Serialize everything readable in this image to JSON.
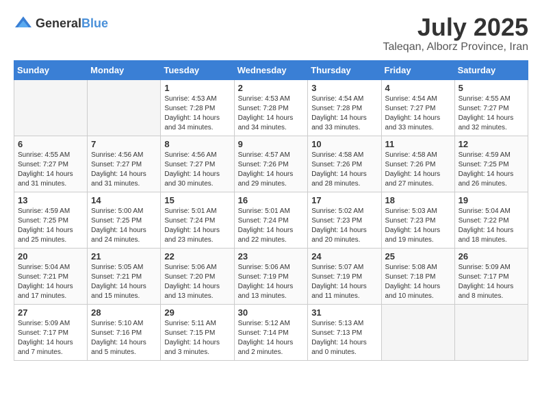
{
  "header": {
    "logo_general": "General",
    "logo_blue": "Blue",
    "month": "July 2025",
    "location": "Taleqan, Alborz Province, Iran"
  },
  "days_of_week": [
    "Sunday",
    "Monday",
    "Tuesday",
    "Wednesday",
    "Thursday",
    "Friday",
    "Saturday"
  ],
  "weeks": [
    [
      {
        "day": "",
        "sunrise": "",
        "sunset": "",
        "daylight": ""
      },
      {
        "day": "",
        "sunrise": "",
        "sunset": "",
        "daylight": ""
      },
      {
        "day": "1",
        "sunrise": "Sunrise: 4:53 AM",
        "sunset": "Sunset: 7:28 PM",
        "daylight": "Daylight: 14 hours and 34 minutes."
      },
      {
        "day": "2",
        "sunrise": "Sunrise: 4:53 AM",
        "sunset": "Sunset: 7:28 PM",
        "daylight": "Daylight: 14 hours and 34 minutes."
      },
      {
        "day": "3",
        "sunrise": "Sunrise: 4:54 AM",
        "sunset": "Sunset: 7:28 PM",
        "daylight": "Daylight: 14 hours and 33 minutes."
      },
      {
        "day": "4",
        "sunrise": "Sunrise: 4:54 AM",
        "sunset": "Sunset: 7:27 PM",
        "daylight": "Daylight: 14 hours and 33 minutes."
      },
      {
        "day": "5",
        "sunrise": "Sunrise: 4:55 AM",
        "sunset": "Sunset: 7:27 PM",
        "daylight": "Daylight: 14 hours and 32 minutes."
      }
    ],
    [
      {
        "day": "6",
        "sunrise": "Sunrise: 4:55 AM",
        "sunset": "Sunset: 7:27 PM",
        "daylight": "Daylight: 14 hours and 31 minutes."
      },
      {
        "day": "7",
        "sunrise": "Sunrise: 4:56 AM",
        "sunset": "Sunset: 7:27 PM",
        "daylight": "Daylight: 14 hours and 31 minutes."
      },
      {
        "day": "8",
        "sunrise": "Sunrise: 4:56 AM",
        "sunset": "Sunset: 7:27 PM",
        "daylight": "Daylight: 14 hours and 30 minutes."
      },
      {
        "day": "9",
        "sunrise": "Sunrise: 4:57 AM",
        "sunset": "Sunset: 7:26 PM",
        "daylight": "Daylight: 14 hours and 29 minutes."
      },
      {
        "day": "10",
        "sunrise": "Sunrise: 4:58 AM",
        "sunset": "Sunset: 7:26 PM",
        "daylight": "Daylight: 14 hours and 28 minutes."
      },
      {
        "day": "11",
        "sunrise": "Sunrise: 4:58 AM",
        "sunset": "Sunset: 7:26 PM",
        "daylight": "Daylight: 14 hours and 27 minutes."
      },
      {
        "day": "12",
        "sunrise": "Sunrise: 4:59 AM",
        "sunset": "Sunset: 7:25 PM",
        "daylight": "Daylight: 14 hours and 26 minutes."
      }
    ],
    [
      {
        "day": "13",
        "sunrise": "Sunrise: 4:59 AM",
        "sunset": "Sunset: 7:25 PM",
        "daylight": "Daylight: 14 hours and 25 minutes."
      },
      {
        "day": "14",
        "sunrise": "Sunrise: 5:00 AM",
        "sunset": "Sunset: 7:25 PM",
        "daylight": "Daylight: 14 hours and 24 minutes."
      },
      {
        "day": "15",
        "sunrise": "Sunrise: 5:01 AM",
        "sunset": "Sunset: 7:24 PM",
        "daylight": "Daylight: 14 hours and 23 minutes."
      },
      {
        "day": "16",
        "sunrise": "Sunrise: 5:01 AM",
        "sunset": "Sunset: 7:24 PM",
        "daylight": "Daylight: 14 hours and 22 minutes."
      },
      {
        "day": "17",
        "sunrise": "Sunrise: 5:02 AM",
        "sunset": "Sunset: 7:23 PM",
        "daylight": "Daylight: 14 hours and 20 minutes."
      },
      {
        "day": "18",
        "sunrise": "Sunrise: 5:03 AM",
        "sunset": "Sunset: 7:23 PM",
        "daylight": "Daylight: 14 hours and 19 minutes."
      },
      {
        "day": "19",
        "sunrise": "Sunrise: 5:04 AM",
        "sunset": "Sunset: 7:22 PM",
        "daylight": "Daylight: 14 hours and 18 minutes."
      }
    ],
    [
      {
        "day": "20",
        "sunrise": "Sunrise: 5:04 AM",
        "sunset": "Sunset: 7:21 PM",
        "daylight": "Daylight: 14 hours and 17 minutes."
      },
      {
        "day": "21",
        "sunrise": "Sunrise: 5:05 AM",
        "sunset": "Sunset: 7:21 PM",
        "daylight": "Daylight: 14 hours and 15 minutes."
      },
      {
        "day": "22",
        "sunrise": "Sunrise: 5:06 AM",
        "sunset": "Sunset: 7:20 PM",
        "daylight": "Daylight: 14 hours and 13 minutes."
      },
      {
        "day": "23",
        "sunrise": "Sunrise: 5:06 AM",
        "sunset": "Sunset: 7:19 PM",
        "daylight": "Daylight: 14 hours and 13 minutes."
      },
      {
        "day": "24",
        "sunrise": "Sunrise: 5:07 AM",
        "sunset": "Sunset: 7:19 PM",
        "daylight": "Daylight: 14 hours and 11 minutes."
      },
      {
        "day": "25",
        "sunrise": "Sunrise: 5:08 AM",
        "sunset": "Sunset: 7:18 PM",
        "daylight": "Daylight: 14 hours and 10 minutes."
      },
      {
        "day": "26",
        "sunrise": "Sunrise: 5:09 AM",
        "sunset": "Sunset: 7:17 PM",
        "daylight": "Daylight: 14 hours and 8 minutes."
      }
    ],
    [
      {
        "day": "27",
        "sunrise": "Sunrise: 5:09 AM",
        "sunset": "Sunset: 7:17 PM",
        "daylight": "Daylight: 14 hours and 7 minutes."
      },
      {
        "day": "28",
        "sunrise": "Sunrise: 5:10 AM",
        "sunset": "Sunset: 7:16 PM",
        "daylight": "Daylight: 14 hours and 5 minutes."
      },
      {
        "day": "29",
        "sunrise": "Sunrise: 5:11 AM",
        "sunset": "Sunset: 7:15 PM",
        "daylight": "Daylight: 14 hours and 3 minutes."
      },
      {
        "day": "30",
        "sunrise": "Sunrise: 5:12 AM",
        "sunset": "Sunset: 7:14 PM",
        "daylight": "Daylight: 14 hours and 2 minutes."
      },
      {
        "day": "31",
        "sunrise": "Sunrise: 5:13 AM",
        "sunset": "Sunset: 7:13 PM",
        "daylight": "Daylight: 14 hours and 0 minutes."
      },
      {
        "day": "",
        "sunrise": "",
        "sunset": "",
        "daylight": ""
      },
      {
        "day": "",
        "sunrise": "",
        "sunset": "",
        "daylight": ""
      }
    ]
  ]
}
